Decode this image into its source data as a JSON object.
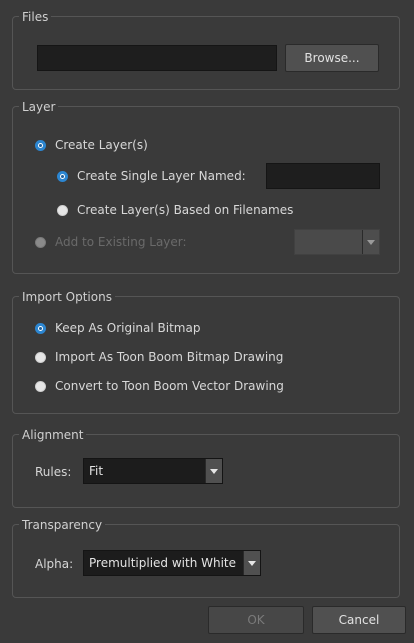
{
  "files": {
    "title": "Files",
    "path_value": "",
    "browse_label": "Browse..."
  },
  "layer": {
    "title": "Layer",
    "create_layers": "Create Layer(s)",
    "create_single": "Create Single Layer Named:",
    "single_name_value": "",
    "based_on_filenames": "Create Layer(s) Based on Filenames",
    "add_existing": "Add to Existing Layer:",
    "existing_layer_value": ""
  },
  "import_options": {
    "title": "Import Options",
    "keep_original": "Keep As Original Bitmap",
    "import_toon_bitmap": "Import As Toon Boom Bitmap Drawing",
    "convert_vector": "Convert to Toon Boom Vector Drawing"
  },
  "alignment": {
    "title": "Alignment",
    "rules_label": "Rules:",
    "rules_value": "Fit"
  },
  "transparency": {
    "title": "Transparency",
    "alpha_label": "Alpha:",
    "alpha_value": "Premultiplied with White"
  },
  "footer": {
    "ok_label": "OK",
    "cancel_label": "Cancel"
  },
  "colors": {
    "background": "#3a3a3a",
    "accent": "#2c86d1"
  }
}
